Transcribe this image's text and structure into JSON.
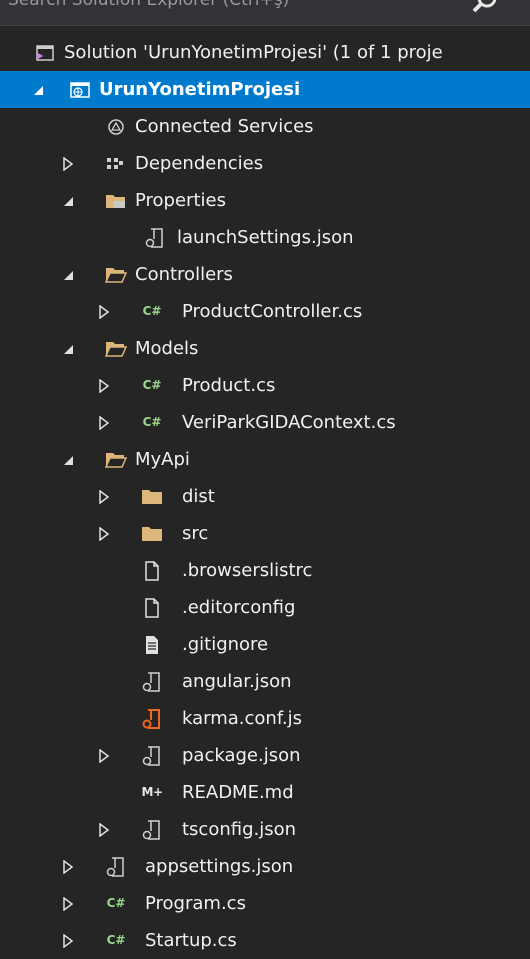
{
  "search": {
    "placeholder": "Search Solution Explorer (Ctrl+ş)"
  },
  "tree": [
    {
      "label": "Solution 'UrunYonetimProjesi' (1 of 1 proje",
      "icon": "solution-icon",
      "expander": "none"
    },
    {
      "label": "UrunYonetimProjesi",
      "icon": "web-project-icon",
      "expander": "expanded",
      "selected": true
    },
    {
      "label": "Connected Services",
      "icon": "connected-services-icon",
      "expander": "none"
    },
    {
      "label": "Dependencies",
      "icon": "dependencies-icon",
      "expander": "collapsed"
    },
    {
      "label": "Properties",
      "icon": "properties-folder-icon",
      "expander": "expanded"
    },
    {
      "label": "launchSettings.json",
      "icon": "json-file-icon",
      "expander": "none"
    },
    {
      "label": "Controllers",
      "icon": "folder-open-icon",
      "expander": "expanded"
    },
    {
      "label": "ProductController.cs",
      "icon": "csharp-file-icon",
      "expander": "collapsed"
    },
    {
      "label": "Models",
      "icon": "folder-open-icon",
      "expander": "expanded"
    },
    {
      "label": "Product.cs",
      "icon": "csharp-file-icon",
      "expander": "collapsed"
    },
    {
      "label": "VeriParkGIDAContext.cs",
      "icon": "csharp-file-icon",
      "expander": "collapsed"
    },
    {
      "label": "MyApi",
      "icon": "folder-open-icon",
      "expander": "expanded"
    },
    {
      "label": "dist",
      "icon": "folder-closed-icon",
      "expander": "collapsed"
    },
    {
      "label": "src",
      "icon": "folder-closed-icon",
      "expander": "collapsed"
    },
    {
      "label": ".browserslistrc",
      "icon": "blank-file-icon",
      "expander": "none"
    },
    {
      "label": ".editorconfig",
      "icon": "blank-file-icon",
      "expander": "none"
    },
    {
      "label": ".gitignore",
      "icon": "text-file-icon",
      "expander": "none"
    },
    {
      "label": "angular.json",
      "icon": "json-file-icon",
      "expander": "none"
    },
    {
      "label": "karma.conf.js",
      "icon": "js-config-file-icon",
      "expander": "none"
    },
    {
      "label": "package.json",
      "icon": "json-file-icon",
      "expander": "collapsed"
    },
    {
      "label": "README.md",
      "icon": "markdown-icon",
      "expander": "none"
    },
    {
      "label": "tsconfig.json",
      "icon": "json-file-icon",
      "expander": "collapsed"
    },
    {
      "label": "appsettings.json",
      "icon": "json-file-icon",
      "expander": "collapsed"
    },
    {
      "label": "Program.cs",
      "icon": "csharp-file-icon",
      "expander": "collapsed"
    },
    {
      "label": "Startup.cs",
      "icon": "csharp-file-icon",
      "expander": "collapsed"
    }
  ],
  "icon_text": {
    "csharp": "C#",
    "markdown": "M+"
  },
  "colors": {
    "background": "#252526",
    "selection": "#007acc",
    "text": "#f1f1f1",
    "folder": "#dcb67a",
    "csharp": "#9bd68d",
    "js_config": "#f26522"
  }
}
